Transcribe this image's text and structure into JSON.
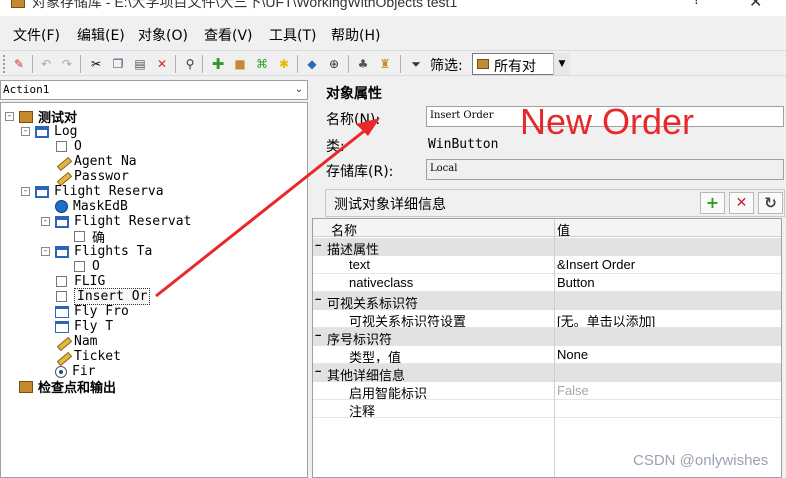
{
  "window": {
    "title": "对象存储库 - E:\\大学项目文件\\大三下\\UFT\\WorkingWithObjects test1",
    "help_glyph": "?",
    "close_glyph": "✕"
  },
  "menu": [
    "文件(F)",
    "编辑(E)",
    "对象(O)",
    "查看(V)",
    "工具(T)",
    "帮助(H)"
  ],
  "toolbar": {
    "icons": [
      "highlight-icon",
      "undo-icon",
      "redo-icon",
      "cut-icon",
      "copy-icon",
      "paste-icon",
      "delete-icon",
      "find-icon",
      "add-objects-icon",
      "add-local-icon",
      "object-spy-icon",
      "highlight-in-app-icon",
      "export-icon",
      "merge-icon",
      "locate-icon",
      "manage-icon",
      "filter-icon"
    ],
    "filter_label": "筛选:",
    "filter_value": "所有对"
  },
  "action_selector": {
    "value": "Action1"
  },
  "tree": [
    {
      "label": "测试对",
      "level": 0,
      "icon": "object",
      "bold": true,
      "expand": "-"
    },
    {
      "label": "Log",
      "level": 1,
      "icon": "window",
      "expand": "-"
    },
    {
      "label": "O",
      "level": 2,
      "icon": "checkbox"
    },
    {
      "label": "Agent Na",
      "level": 2,
      "icon": "edit"
    },
    {
      "label": "Passwor",
      "level": 2,
      "icon": "edit"
    },
    {
      "label": "Flight Reserva",
      "level": 1,
      "icon": "window",
      "expand": "-"
    },
    {
      "label": "MaskEdB",
      "level": 2,
      "icon": "mask"
    },
    {
      "label": "Flight Reservat",
      "level": 2,
      "icon": "window",
      "expand": "-"
    },
    {
      "label": "确",
      "level": 3,
      "icon": "checkbox"
    },
    {
      "label": "Flights Ta",
      "level": 2,
      "icon": "window",
      "expand": "-"
    },
    {
      "label": "O",
      "level": 3,
      "icon": "checkbox"
    },
    {
      "label": "FLIG",
      "level": 2,
      "icon": "checkbox"
    },
    {
      "label": "Insert Or",
      "level": 2,
      "icon": "checkbox",
      "selected": true
    },
    {
      "label": "Fly Fro",
      "level": 2,
      "icon": "list"
    },
    {
      "label": "Fly T",
      "level": 2,
      "icon": "list"
    },
    {
      "label": "Nam",
      "level": 2,
      "icon": "edit"
    },
    {
      "label": "Ticket",
      "level": 2,
      "icon": "edit"
    },
    {
      "label": "Fir",
      "level": 2,
      "icon": "radio"
    },
    {
      "label": "检查点和输出",
      "level": 0,
      "icon": "object",
      "bold": true
    }
  ],
  "properties": {
    "section_title": "对象属性",
    "name_label": "名称(N):",
    "name_value": "Insert Order",
    "class_label": "类:",
    "class_value": "WinButton",
    "repo_label": "存储库(R):",
    "repo_value": "Local"
  },
  "details": {
    "title": "测试对象详细信息",
    "buttons": [
      "+",
      "✕",
      "↻"
    ],
    "col_name": "名称",
    "col_value": "值",
    "rows": [
      {
        "type": "category",
        "name": "描述属性"
      },
      {
        "type": "item",
        "name": "text",
        "value": "&Insert Order"
      },
      {
        "type": "item",
        "name": "nativeclass",
        "value": "Button"
      },
      {
        "type": "category",
        "name": "可视关系标识符"
      },
      {
        "type": "item",
        "name": "可视关系标识符设置",
        "value": "[无。单击以添加]"
      },
      {
        "type": "category",
        "name": "序号标识符"
      },
      {
        "type": "item",
        "name": "类型，值",
        "value": "None"
      },
      {
        "type": "category",
        "name": "其他详细信息"
      },
      {
        "type": "item",
        "name": "启用智能标识",
        "value": "False",
        "muted": true
      },
      {
        "type": "item",
        "name": "注释",
        "value": ""
      }
    ]
  },
  "annotation": {
    "text": "New Order",
    "color": "#e8282a"
  },
  "watermark": "CSDN @onlywishes"
}
